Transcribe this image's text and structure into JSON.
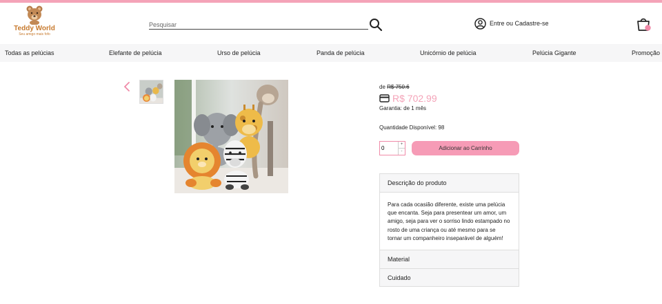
{
  "colors": {
    "accent": "#f4a3b8",
    "button": "#f69bb6",
    "nav_bg": "#f6f6f7"
  },
  "header": {
    "brand": "Teddy World",
    "tagline": "Seu amigo mais fofo",
    "search_placeholder": "Pesquisar",
    "account_label": "Entre ou Cadastre-se"
  },
  "nav": {
    "items": [
      "Todas as pelúcias",
      "Elefante de pelúcia",
      "Urso de pelúcia",
      "Panda de pelúcia",
      "Unicórnio de pelúcia",
      "Pelúcia Gigante",
      "Promoção"
    ]
  },
  "product": {
    "old_price_prefix": "de",
    "old_price": "R$ 750.6",
    "price": "R$ 702.99",
    "warranty": "Garantia: de 1 mês",
    "quantity_available": "Quantidade Disponível: 98",
    "quantity_value": "0",
    "add_to_cart": "Adicionar ao Carrinho"
  },
  "accordion": {
    "description_title": "Descrição do produto",
    "description_text": "Para cada ocasião diferente, existe uma pelúcia que encanta. Seja para presentear um amor, um amigo, seja para ver o sorriso lindo estampado no rosto de uma criança ou até mesmo para se tornar um companheiro inseparável de alguém!",
    "material_title": "Material",
    "care_title": "Cuidado"
  },
  "icons": [
    "teddy-logo-icon",
    "search-icon",
    "user-icon",
    "cart-icon",
    "chevron-left-icon",
    "card-icon"
  ]
}
